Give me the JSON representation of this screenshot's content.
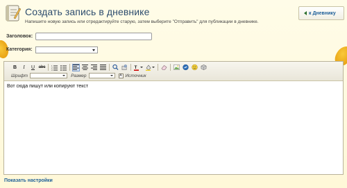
{
  "header": {
    "title": "Создать запись в дневнике",
    "subtitle": "Напишите новую запись или отредактируйте старую, затем выберите \"Отправить\" для публикации в дневнике.",
    "back_button": "к Дневнику",
    "icon": "diary-notebook-icon"
  },
  "form": {
    "subject_label": "Заголовок:",
    "subject_value": "",
    "category_label": "Категория:",
    "category_selected": ""
  },
  "toolbar": {
    "bold": "B",
    "italic": "I",
    "underline": "U",
    "strike": "abc",
    "font_label": "Шрифт",
    "font_value": "",
    "size_label": "Размер",
    "size_value": "",
    "source_label": "Источник",
    "source_box": "A",
    "buttons": [
      "bold",
      "italic",
      "underline",
      "strikethrough",
      "numbered-list",
      "bullet-list",
      "align-left",
      "align-center",
      "align-right",
      "justify",
      "spellcheck",
      "image-upload",
      "text-color",
      "background-color",
      "eraser",
      "insert-image",
      "insert-link",
      "emoticon",
      "special"
    ]
  },
  "editor": {
    "content": "Вот сюда пишут или копируют текст"
  },
  "footer": {
    "show_settings": "Показать настройки"
  },
  "colors": {
    "background": "#fffbe6",
    "title": "#2d4d6e",
    "link": "#1d5f98",
    "leaf": "#e9a315"
  }
}
